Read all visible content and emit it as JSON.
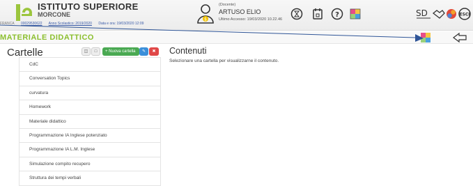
{
  "header": {
    "school_name": "ISTITUTO SUPERIORE",
    "school_city": "MORCONE",
    "meta_code": "00029530622",
    "meta_year": "Anno Scolastico: 2019/2020",
    "meta_datetime": "Data e ora: 19/03/2020 12:09",
    "meta_prefix": "FRANCA",
    "user_role": "(Docente)",
    "user_name": "ARTUSO ELIO",
    "user_last_access": "Ultimo Accesso: 19/03/2020 10.22.46",
    "icons": [
      "timer-icon",
      "calendar-icon",
      "help-icon",
      "puzzle-icon",
      "sd-logo-icon",
      "handshake-icon",
      "apps-icon",
      "exit-icon"
    ]
  },
  "section": {
    "title": "MATERIALE DIDATTICO",
    "icons": [
      "puzzle-icon",
      "back-arrow-icon"
    ]
  },
  "folders": {
    "title": "Cartelle",
    "new_folder_label": "+ Nuova cartella",
    "items": [
      "CdC",
      "Conversation Topics",
      "curvatura",
      "Homework",
      "Materiale didattico",
      "Programmazione IA Inglese potenziato",
      "Programmazione IA L.M. Inglese",
      "Simulazione compito recupero",
      "Struttura dei tempi verbali"
    ]
  },
  "content": {
    "title": "Contenuti",
    "placeholder": "Selezionare una cartella per visualizzarne il contenuto."
  },
  "colors": {
    "accent_green": "#8cbf2f",
    "button_green": "#4aa952",
    "button_blue": "#3b8fd9",
    "button_red": "#e04848",
    "link_blue": "#3a5ba8"
  }
}
